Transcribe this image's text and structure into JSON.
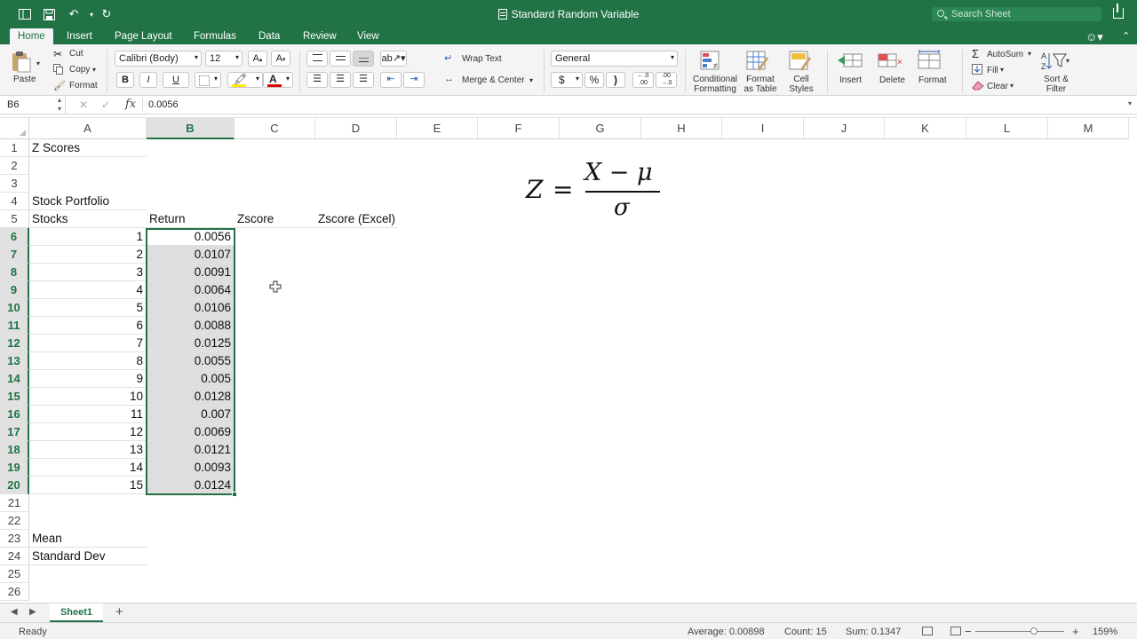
{
  "titlebar": {
    "title": "Standard Random Variable",
    "search_placeholder": "Search Sheet"
  },
  "ribbon_tabs": [
    "Home",
    "Insert",
    "Page Layout",
    "Formulas",
    "Data",
    "Review",
    "View"
  ],
  "active_tab": "Home",
  "ribbon": {
    "paste": "Paste",
    "cut": "Cut",
    "copy": "Copy",
    "format_painter": "Format",
    "font_name": "Calibri (Body)",
    "font_size": "12",
    "bold": "B",
    "italic": "I",
    "underline": "U",
    "wrap_text": "Wrap Text",
    "merge_center": "Merge & Center",
    "number_format": "General",
    "currency": "$",
    "percent": "%",
    "comma": ")",
    "conditional_formatting": "Conditional Formatting",
    "format_as_table": "Format as Table",
    "cell_styles": "Cell Styles",
    "insert": "Insert",
    "delete": "Delete",
    "format": "Format",
    "autosum": "AutoSum",
    "fill": "Fill",
    "clear": "Clear",
    "sort_filter": "Sort & Filter"
  },
  "formula_bar": {
    "name_box": "B6",
    "fx": "fx",
    "content": "0.0056"
  },
  "columns": [
    "A",
    "B",
    "C",
    "D",
    "E",
    "F",
    "G",
    "H",
    "I",
    "J",
    "K",
    "L",
    "M"
  ],
  "selected_column": "B",
  "rows": [
    "1",
    "2",
    "3",
    "4",
    "5",
    "6",
    "7",
    "8",
    "9",
    "10",
    "11",
    "12",
    "13",
    "14",
    "15",
    "16",
    "17",
    "18",
    "19",
    "20",
    "21",
    "22",
    "23",
    "24",
    "25",
    "26"
  ],
  "selected_rows": [
    "6",
    "7",
    "8",
    "9",
    "10",
    "11",
    "12",
    "13",
    "14",
    "15",
    "16",
    "17",
    "18",
    "19",
    "20"
  ],
  "cells": {
    "A1": "Z Scores",
    "A4": "Stock Portfolio",
    "A5": "Stocks",
    "B5": "Return",
    "C5": "Zscore",
    "D5": "Zscore (Excel)",
    "A23": "Mean",
    "A24": "Standard Dev"
  },
  "stocks": [
    "1",
    "2",
    "3",
    "4",
    "5",
    "6",
    "7",
    "8",
    "9",
    "10",
    "11",
    "12",
    "13",
    "14",
    "15"
  ],
  "returns": [
    "0.0056",
    "0.0107",
    "0.0091",
    "0.0064",
    "0.0106",
    "0.0088",
    "0.0125",
    "0.0055",
    "0.005",
    "0.0128",
    "0.007",
    "0.0069",
    "0.0121",
    "0.0093",
    "0.0124"
  ],
  "formula_image": {
    "lhs": "Z",
    "eq": "=",
    "numerator": "X − μ",
    "denominator": "σ"
  },
  "sheet_tabs": [
    "Sheet1"
  ],
  "status": {
    "ready": "Ready",
    "average": "Average: 0.00898",
    "count": "Count: 15",
    "sum": "Sum: 0.1347",
    "zoom": "159%"
  },
  "colors": {
    "excel_green": "#217346",
    "selection_fill": "#dedede"
  }
}
